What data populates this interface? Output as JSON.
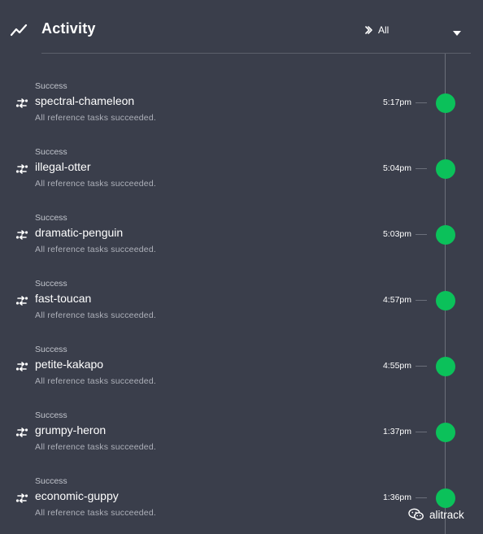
{
  "header": {
    "title": "Activity",
    "icon": "trending-up-icon",
    "filter": {
      "label": "All",
      "icon": "chevron-right-double-icon"
    }
  },
  "items": [
    {
      "status": "Success",
      "name": "spectral-chameleon",
      "description": "All reference tasks succeeded.",
      "time": "5:17pm",
      "dot_color": "#0bc15a"
    },
    {
      "status": "Success",
      "name": "illegal-otter",
      "description": "All reference tasks succeeded.",
      "time": "5:04pm",
      "dot_color": "#0bc15a"
    },
    {
      "status": "Success",
      "name": "dramatic-penguin",
      "description": "All reference tasks succeeded.",
      "time": "5:03pm",
      "dot_color": "#0bc15a"
    },
    {
      "status": "Success",
      "name": "fast-toucan",
      "description": "All reference tasks succeeded.",
      "time": "4:57pm",
      "dot_color": "#0bc15a"
    },
    {
      "status": "Success",
      "name": "petite-kakapo",
      "description": "All reference tasks succeeded.",
      "time": "4:55pm",
      "dot_color": "#0bc15a"
    },
    {
      "status": "Success",
      "name": "grumpy-heron",
      "description": "All reference tasks succeeded.",
      "time": "1:37pm",
      "dot_color": "#0bc15a"
    },
    {
      "status": "Success",
      "name": "economic-guppy",
      "description": "All reference tasks succeeded.",
      "time": "1:36pm",
      "dot_color": "#0bc15a"
    }
  ],
  "watermark": {
    "text": "alitrack",
    "icon": "wechat-icon"
  },
  "colors": {
    "background": "#3a3e4b",
    "success": "#0bc15a",
    "divider": "#5b5f6b"
  }
}
